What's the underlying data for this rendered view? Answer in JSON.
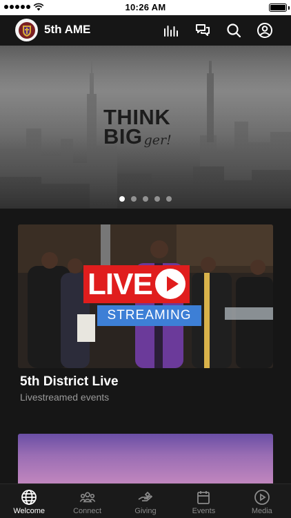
{
  "status_bar": {
    "time": "10:26 AM"
  },
  "header": {
    "title": "5th AME",
    "icons": [
      "bars-chart-icon",
      "chat-icon",
      "search-icon",
      "profile-icon"
    ]
  },
  "hero": {
    "line1": "THINK",
    "line2": "BIG",
    "line2_suffix": "ger!",
    "slide_count": 5,
    "active_slide": 1
  },
  "featured": {
    "badge_live": "LIVE",
    "badge_streaming": "STREAMING",
    "title": "5th District Live",
    "subtitle": "Livestreamed events"
  },
  "tabs": [
    {
      "label": "Welcome",
      "icon": "globe-icon",
      "active": true
    },
    {
      "label": "Connect",
      "icon": "people-icon",
      "active": false
    },
    {
      "label": "Giving",
      "icon": "giving-hand-icon",
      "active": false
    },
    {
      "label": "Events",
      "icon": "calendar-icon",
      "active": false
    },
    {
      "label": "Media",
      "icon": "play-circle-icon",
      "active": false
    }
  ],
  "colors": {
    "background": "#161616",
    "live_red": "#e01d1d",
    "streaming_blue": "#3d7fd6",
    "muted_text": "#9a9a9a"
  }
}
